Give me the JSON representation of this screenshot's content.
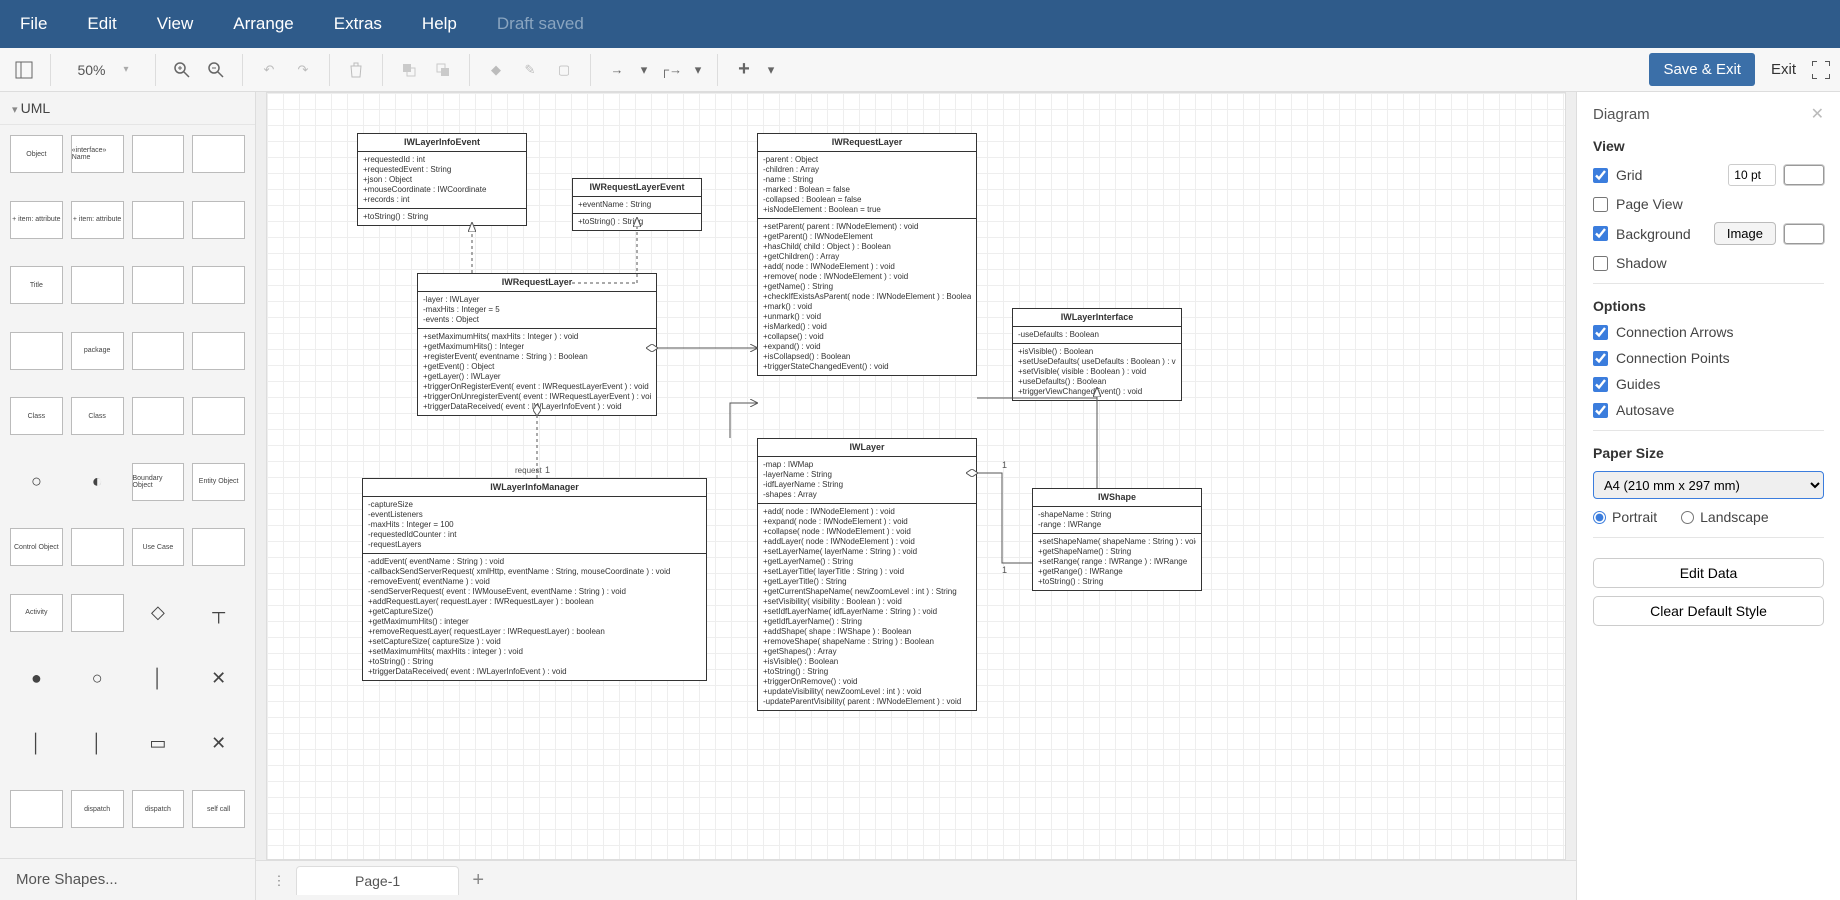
{
  "menubar": {
    "file": "File",
    "edit": "Edit",
    "view": "View",
    "arrange": "Arrange",
    "extras": "Extras",
    "help": "Help",
    "draft_saved": "Draft saved"
  },
  "toolbar": {
    "zoom": "50%",
    "save_exit": "Save & Exit",
    "exit": "Exit"
  },
  "sidebar_left": {
    "panel_title": "UML",
    "more_shapes": "More Shapes...",
    "shapes": [
      "Object",
      "«interface» Name",
      "",
      "",
      "+ item: attribute",
      "+ item: attribute",
      "",
      "",
      "Title",
      "",
      "",
      "",
      "",
      "package",
      "",
      "",
      "Class",
      "Class",
      "",
      "",
      "○",
      "◐",
      "Boundary Object",
      "Entity Object",
      "Control Object",
      "",
      "Use Case",
      "",
      "Activity",
      "",
      "◇",
      "┬",
      "●",
      "○",
      "│",
      "✕",
      "│",
      "│",
      "▭",
      "✕",
      "",
      "dispatch",
      "dispatch",
      "self call"
    ]
  },
  "tabs": {
    "page1": "Page-1"
  },
  "sidebar_right": {
    "title": "Diagram",
    "view_header": "View",
    "grid": "Grid",
    "grid_size": "10 pt",
    "page_view": "Page View",
    "background": "Background",
    "image_btn": "Image",
    "shadow": "Shadow",
    "options_header": "Options",
    "conn_arrows": "Connection Arrows",
    "conn_points": "Connection Points",
    "guides": "Guides",
    "autosave": "Autosave",
    "paper_header": "Paper Size",
    "paper_size": "A4 (210 mm x 297 mm)",
    "portrait": "Portrait",
    "landscape": "Landscape",
    "edit_data": "Edit Data",
    "clear_style": "Clear Default Style"
  },
  "uml_classes": {
    "IWLayerInfoEvent": {
      "title": "IWLayerInfoEvent",
      "attrs": [
        "+requestedId : int",
        "+requestedEvent : String",
        "+json : Object",
        "+mouseCoordinate : IWCoordinate",
        "+records : int"
      ],
      "ops": [
        "+toString() : String"
      ]
    },
    "IWRequestLayerEvent": {
      "title": "IWRequestLayerEvent",
      "attrs": [
        "+eventName : String"
      ],
      "ops": [
        "+toString() : String"
      ]
    },
    "IWRequestLayer_top": {
      "title": "IWRequestLayer",
      "attrs": [
        "-parent : Object",
        "-children : Array",
        "-name : String",
        "-marked : Bolean = false",
        "-collapsed : Boolean = false",
        "+isNodeElement : Boolean = true"
      ],
      "ops": [
        "+setParent( parent : IWNodeElement) : void",
        "+getParent() : IWNodeElement",
        "+hasChild( child : Object ) : Boolean",
        "+getChildren() : Array",
        "+add( node : IWNodeElement ) : void",
        "+remove( node : IWNodeElement ) : void",
        "+getName() : String",
        "+checkIfExistsAsParent( node : IWNodeElement ) : Boolean",
        "+mark() : void",
        "+unmark() : void",
        "+isMarked() : void",
        "+collapse() : void",
        "+expand() : void",
        "+isCollapsed() : Boolean",
        "+triggerStateChangedEvent() : void"
      ]
    },
    "IWRequestLayer_mid": {
      "title": "IWRequestLayer",
      "attrs": [
        "-layer : IWLayer",
        "-maxHits : Integer = 5",
        "-events : Object"
      ],
      "ops": [
        "+setMaximumHits( maxHits : Integer ) : void",
        "+getMaximumHits() : Integer",
        "+registerEvent( eventname : String ) : Boolean",
        "+getEvent() : Object",
        "+getLayer() : IWLayer",
        "+triggerOnRegisterEvent( event : IWRequestLayerEvent ) : void",
        "+triggerOnUnregisterEvent( event : IWRequestLayerEvent ) : void",
        "+triggerDataReceived( event : IWLayerInfoEvent ) : void"
      ]
    },
    "IWLayerInterface": {
      "title": "IWLayerInterface",
      "attrs": [
        "-useDefaults : Boolean"
      ],
      "ops": [
        "+isVisible() : Boolean",
        "+setUseDefaults( useDefaults : Boolean ) : void",
        "+setVisible( visible : Boolean ) : void",
        "+useDefaults() : Boolean",
        "+triggerViewChangedEvent() : void"
      ]
    },
    "IWLayerInfoManager": {
      "title": "IWLayerInfoManager",
      "attrs": [
        "-captureSize",
        "-eventListeners",
        "-maxHits : Integer = 100",
        "-requestedIdCounter : int",
        "-requestLayers"
      ],
      "ops": [
        "-addEvent( eventName : String ) : void",
        "-callbackSendServerRequest( xmlHttp, eventName : String, mouseCoordinate ) : void",
        "-removeEvent( eventName ) : void",
        "-sendServerRequest( event : IWMouseEvent, eventName : String ) : void",
        "+addRequestLayer( requestLayer : IWRequestLayer ) : boolean",
        "+getCaptureSize()",
        "+getMaximumHits() : integer",
        "+removeRequestLayer( requestLayer : IWRequestLayer) : boolean",
        "+setCaptureSize( captureSize ) : void",
        "+setMaximumHits( maxHits : integer ) : void",
        "+toString() : String",
        "+triggerDataReceived( event : IWLayerInfoEvent ) : void"
      ]
    },
    "IWLayer": {
      "title": "IWLayer",
      "attrs": [
        "-map : IWMap",
        "-layerName : String",
        "-idfLayerName : String",
        "-shapes : Array"
      ],
      "ops": [
        "+add( node : IWNodeElement ) : void",
        "+expand( node : IWNodeElement ) : void",
        "+collapse( node : IWNodeElement ) : void",
        "+addLayer( node : IWNodeElement ) : void",
        "+setLayerName( layerName : String ) : void",
        "+getLayerName() : String",
        "+setLayerTitle( layerTitle : String ) : void",
        "+getLayerTitle() : String",
        "+getCurrentShapeName( newZoomLevel : int ) : String",
        "+setVisibility( visibility : Boolean ) : void",
        "+setIdfLayerName( idfLayerName : String ) : void",
        "+getIdfLayerName() : String",
        "+addShape( shape : IWShape ) : Boolean",
        "+removeShape( shapeName : String ) : Boolean",
        "+getShapes() : Array",
        "+isVisible() : Boolean",
        "+toString() : String",
        "+triggerOnRemove() : void",
        "+updateVisibility( newZoomLevel : int ) : void",
        "-updateParentVisibility( parent : IWNodeElement ) : void"
      ]
    },
    "IWShape": {
      "title": "IWShape",
      "attrs": [
        "-shapeName : String",
        "-range : IWRange"
      ],
      "ops": [
        "+setShapeName( shapeName : String ) : void",
        "+getShapeName() : String",
        "+setRange( range : IWRange ) : IWRange",
        "+getRange() : IWRange",
        "+toString() : String"
      ]
    }
  },
  "connector_labels": {
    "one_a": "1",
    "one_b": "1",
    "request": "request"
  }
}
